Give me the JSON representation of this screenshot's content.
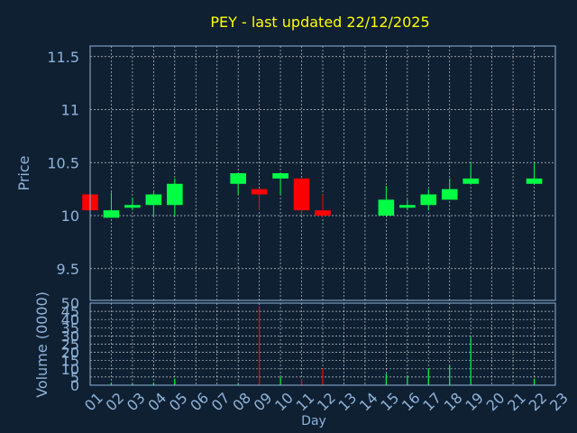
{
  "chart_data": {
    "type": "candlestick",
    "title": "PEY - last updated 22/12/2025",
    "xlabel": "Day",
    "x_ticks": [
      "01",
      "02",
      "03",
      "04",
      "05",
      "06",
      "07",
      "08",
      "09",
      "10",
      "11",
      "12",
      "13",
      "14",
      "15",
      "16",
      "17",
      "18",
      "19",
      "20",
      "21",
      "22",
      "23"
    ],
    "grid": true,
    "colors": {
      "background": "#0f2033",
      "axes": "#8fb3d9",
      "title": "#ffff00",
      "up": "#00ff44",
      "down": "#ff0000",
      "grid": "#ffffff"
    },
    "price": {
      "ylabel": "Price",
      "ylim": [
        9.2,
        11.6
      ],
      "y_ticks": [
        "9.5",
        "10",
        "10.5",
        "11",
        "11.5"
      ],
      "candles": [
        {
          "day": 1,
          "open": 10.2,
          "high": 10.2,
          "low": 10.05,
          "close": 10.05
        },
        {
          "day": 2,
          "open": 9.98,
          "high": 10.22,
          "low": 9.98,
          "close": 10.05
        },
        {
          "day": 3,
          "open": 10.09,
          "high": 10.17,
          "low": 10.05,
          "close": 10.1
        },
        {
          "day": 4,
          "open": 10.1,
          "high": 10.22,
          "low": 10.0,
          "close": 10.2
        },
        {
          "day": 5,
          "open": 10.1,
          "high": 10.35,
          "low": 10.0,
          "close": 10.3
        },
        {
          "day": 8,
          "open": 10.3,
          "high": 10.4,
          "low": 10.2,
          "close": 10.4
        },
        {
          "day": 9,
          "open": 10.25,
          "high": 10.25,
          "low": 10.05,
          "close": 10.2
        },
        {
          "day": 10,
          "open": 10.35,
          "high": 10.4,
          "low": 10.2,
          "close": 10.4
        },
        {
          "day": 11,
          "open": 10.35,
          "high": 10.35,
          "low": 10.0,
          "close": 10.05
        },
        {
          "day": 12,
          "open": 10.05,
          "high": 10.2,
          "low": 9.98,
          "close": 10.0
        },
        {
          "day": 15,
          "open": 10.0,
          "high": 10.28,
          "low": 10.0,
          "close": 10.15
        },
        {
          "day": 16,
          "open": 10.09,
          "high": 10.15,
          "low": 10.05,
          "close": 10.1
        },
        {
          "day": 17,
          "open": 10.1,
          "high": 10.25,
          "low": 10.05,
          "close": 10.2
        },
        {
          "day": 18,
          "open": 10.15,
          "high": 10.35,
          "low": 10.15,
          "close": 10.25
        },
        {
          "day": 19,
          "open": 10.3,
          "high": 10.5,
          "low": 10.3,
          "close": 10.35
        },
        {
          "day": 22,
          "open": 10.3,
          "high": 10.5,
          "low": 10.3,
          "close": 10.35
        }
      ]
    },
    "volume": {
      "ylabel": "Volume (0000)",
      "ylim": [
        0,
        50
      ],
      "y_ticks": [
        "0",
        "5",
        "10",
        "15",
        "20",
        "25",
        "30",
        "35",
        "40",
        "45",
        "50"
      ],
      "bars": [
        {
          "day": 1,
          "value": 0.5,
          "dir": "down"
        },
        {
          "day": 2,
          "value": 1.5,
          "dir": "up"
        },
        {
          "day": 3,
          "value": 1.0,
          "dir": "up"
        },
        {
          "day": 4,
          "value": 1.5,
          "dir": "up"
        },
        {
          "day": 5,
          "value": 4.0,
          "dir": "up"
        },
        {
          "day": 8,
          "value": 1.0,
          "dir": "up"
        },
        {
          "day": 9,
          "value": 48,
          "dir": "down"
        },
        {
          "day": 10,
          "value": 5.0,
          "dir": "up"
        },
        {
          "day": 11,
          "value": 4.0,
          "dir": "down"
        },
        {
          "day": 12,
          "value": 10,
          "dir": "down"
        },
        {
          "day": 15,
          "value": 7.0,
          "dir": "up"
        },
        {
          "day": 16,
          "value": 6.0,
          "dir": "up"
        },
        {
          "day": 17,
          "value": 10,
          "dir": "up"
        },
        {
          "day": 18,
          "value": 12,
          "dir": "up"
        },
        {
          "day": 19,
          "value": 29,
          "dir": "up"
        },
        {
          "day": 22,
          "value": 4.0,
          "dir": "up"
        }
      ]
    }
  }
}
